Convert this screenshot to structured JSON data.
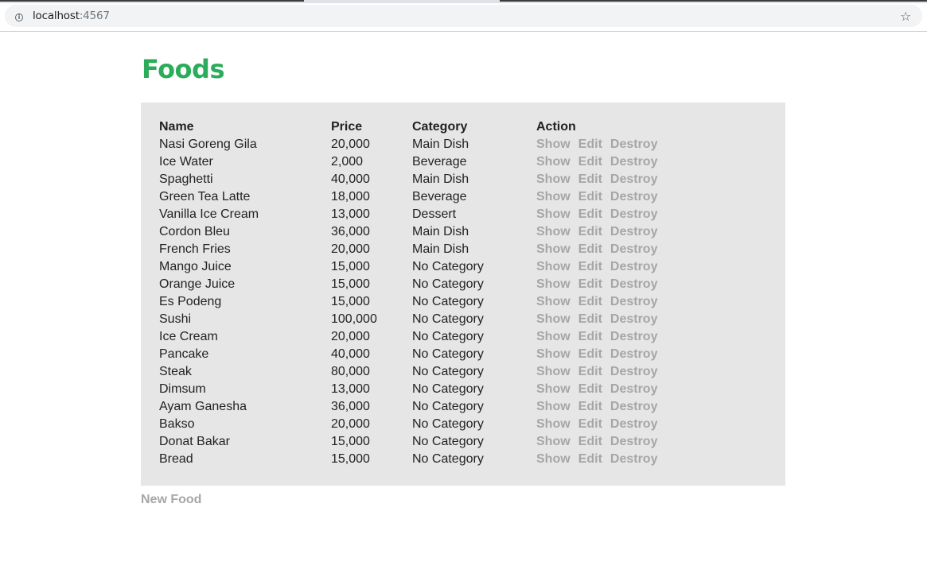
{
  "browser": {
    "url_host": "localhost",
    "url_port": ":4567",
    "info_icon": "info-icon",
    "star_icon": "star-icon"
  },
  "page": {
    "title": "Foods",
    "title_color": "#2bac5a",
    "link_color": "#a6a6a6",
    "panel_color": "#e6e6e6"
  },
  "table": {
    "headers": {
      "name": "Name",
      "price": "Price",
      "category": "Category",
      "action": "Action"
    },
    "rows": [
      {
        "name": "Nasi Goreng Gila",
        "price": "20,000",
        "category": "Main Dish"
      },
      {
        "name": "Ice Water",
        "price": "2,000",
        "category": "Beverage"
      },
      {
        "name": "Spaghetti",
        "price": "40,000",
        "category": "Main Dish"
      },
      {
        "name": "Green Tea Latte",
        "price": "18,000",
        "category": "Beverage"
      },
      {
        "name": "Vanilla Ice Cream",
        "price": "13,000",
        "category": "Dessert"
      },
      {
        "name": "Cordon Bleu",
        "price": "36,000",
        "category": "Main Dish"
      },
      {
        "name": "French Fries",
        "price": "20,000",
        "category": "Main Dish"
      },
      {
        "name": "Mango Juice",
        "price": "15,000",
        "category": "No Category"
      },
      {
        "name": "Orange Juice",
        "price": "15,000",
        "category": "No Category"
      },
      {
        "name": "Es Podeng",
        "price": "15,000",
        "category": "No Category"
      },
      {
        "name": "Sushi",
        "price": "100,000",
        "category": "No Category"
      },
      {
        "name": "Ice Cream",
        "price": "20,000",
        "category": "No Category"
      },
      {
        "name": "Pancake",
        "price": "40,000",
        "category": "No Category"
      },
      {
        "name": "Steak",
        "price": "80,000",
        "category": "No Category"
      },
      {
        "name": "Dimsum",
        "price": "13,000",
        "category": "No Category"
      },
      {
        "name": "Ayam Ganesha",
        "price": "36,000",
        "category": "No Category"
      },
      {
        "name": "Bakso",
        "price": "20,000",
        "category": "No Category"
      },
      {
        "name": "Donat Bakar",
        "price": "15,000",
        "category": "No Category"
      },
      {
        "name": "Bread",
        "price": "15,000",
        "category": "No Category"
      }
    ],
    "actions": {
      "show": "Show",
      "edit": "Edit",
      "destroy": "Destroy"
    }
  },
  "new_food_label": "New Food"
}
